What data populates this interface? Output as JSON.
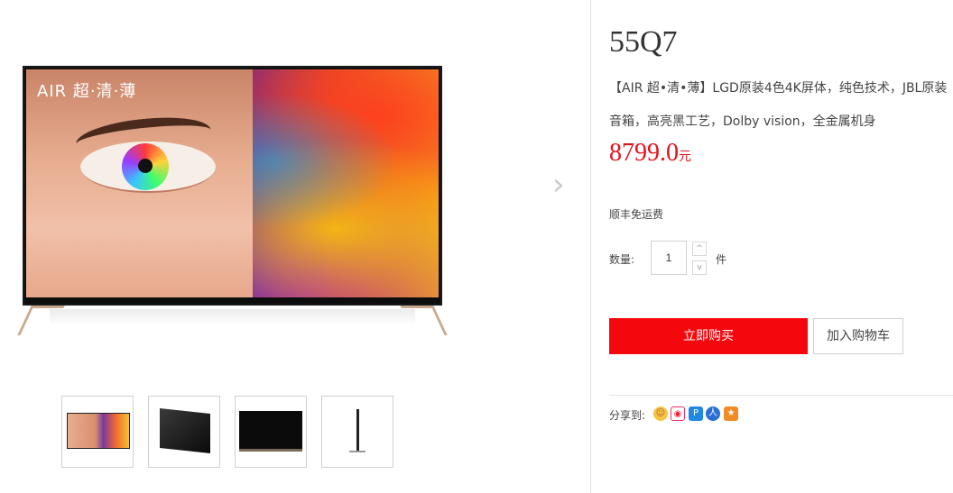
{
  "product": {
    "title": "55Q7",
    "description": "【AIR 超•清•薄】LGD原装4色4K屏体，纯色技术，JBL原装音箱，高亮黑工艺，Dolby vision，全金属机身",
    "price_value": "8799.0",
    "price_unit": "元",
    "shipping": "顺丰免运费"
  },
  "gallery": {
    "main_image_logo": "AIR 超·清·薄",
    "next_arrow": "›",
    "thumbnails": [
      "front-view",
      "angle-view",
      "back-view",
      "side-view"
    ]
  },
  "purchase": {
    "quantity_label": "数量:",
    "quantity_value": "1",
    "quantity_unit": "件",
    "step_up": "^",
    "step_down": "v",
    "buy_now": "立即购买",
    "add_to_cart": "加入购物车"
  },
  "share": {
    "label": "分享到:",
    "icons": [
      "qzone-icon",
      "weibo-icon",
      "tencent-weibo-icon",
      "renren-icon",
      "kaixin-icon"
    ]
  },
  "colors": {
    "accent": "#f4080e",
    "price": "#e4121c"
  }
}
